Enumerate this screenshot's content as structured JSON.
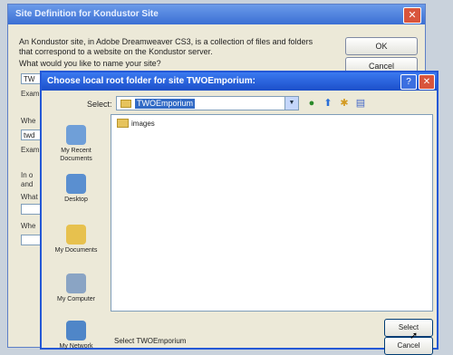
{
  "back_window": {
    "title": "Site Definition for Kondustor Site",
    "description": "An Kondustor site, in Adobe Dreamweaver CS3, is a collection of files and folders that correspond to a website on the Kondustor server.",
    "question": "What would you like to name your site?",
    "ok_label": "OK",
    "cancel_label": "Cancel",
    "fragments": {
      "tw": "TW",
      "exa1": "Exam",
      "whe1": "Whe",
      "twd": "twd",
      "exa2": "Exam",
      "in_o": "In o",
      "and": "and",
      "wha": "What",
      "whe2": "Whe"
    }
  },
  "dialog": {
    "title": "Choose local root folder for site TWOEmporium:",
    "select_label": "Select:",
    "path_value": "TWOEmporium",
    "places": [
      {
        "label": "My Recent Documents",
        "icon": "recent-documents-icon"
      },
      {
        "label": "Desktop",
        "icon": "desktop-icon"
      },
      {
        "label": "My Documents",
        "icon": "my-documents-icon"
      },
      {
        "label": "My Computer",
        "icon": "my-computer-icon"
      },
      {
        "label": "My Network",
        "icon": "my-network-icon"
      }
    ],
    "files": [
      {
        "name": "images"
      }
    ],
    "footer_text": "Select TWOEmporium",
    "select_button": "Select",
    "cancel_button": "Cancel"
  },
  "colors": {
    "titlebar": "#2458d6",
    "dialog_bg": "#ece9d8",
    "close": "#d9553c",
    "selection": "#316ac5"
  }
}
